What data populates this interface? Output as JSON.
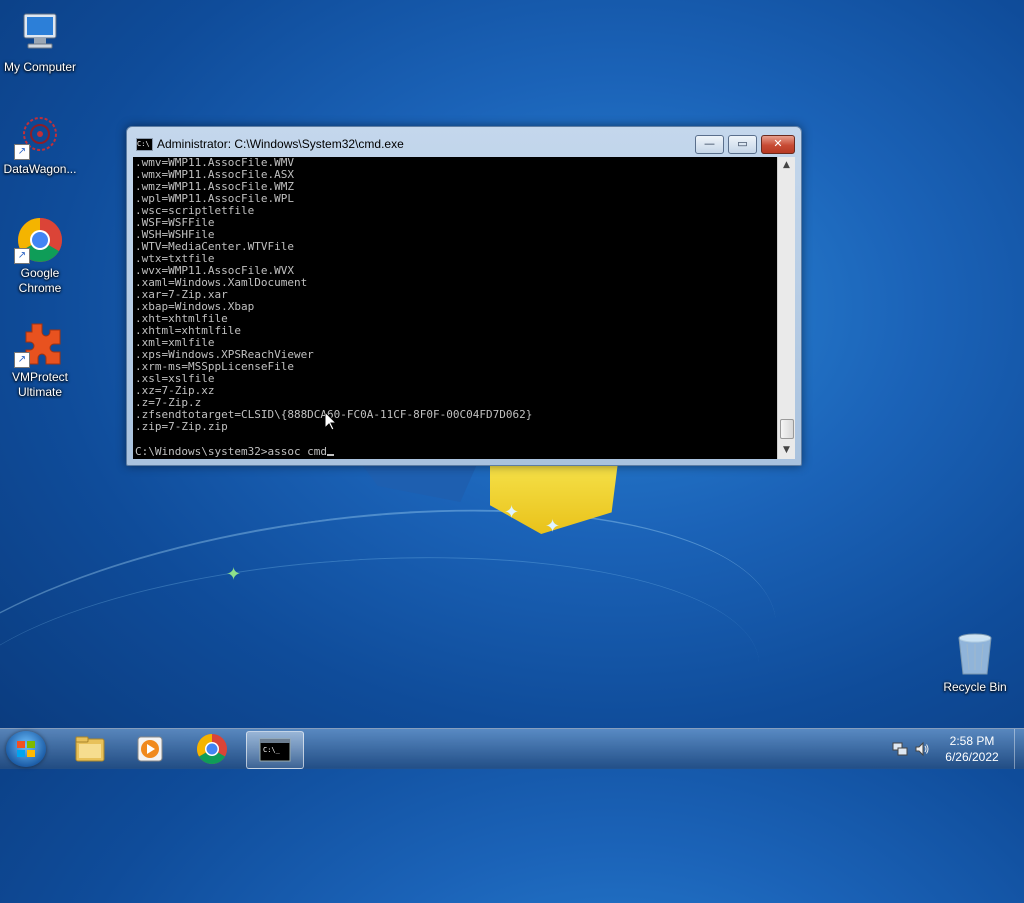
{
  "desktop": {
    "icons": [
      {
        "label": "My Computer"
      },
      {
        "label": "DataWagon..."
      },
      {
        "label": "Google Chrome"
      },
      {
        "label": "VMProtect Ultimate"
      },
      {
        "label": "Recycle Bin"
      }
    ]
  },
  "window": {
    "title": "Administrator: C:\\Windows\\System32\\cmd.exe",
    "icon_text": "C:\\",
    "minimize_label": "—",
    "maximize_label": "▭",
    "close_label": "✕"
  },
  "console": {
    "lines": [
      ".wmv=WMP11.AssocFile.WMV",
      ".wmx=WMP11.AssocFile.ASX",
      ".wmz=WMP11.AssocFile.WMZ",
      ".wpl=WMP11.AssocFile.WPL",
      ".wsc=scriptletfile",
      ".WSF=WSFFile",
      ".WSH=WSHFile",
      ".WTV=MediaCenter.WTVFile",
      ".wtx=txtfile",
      ".wvx=WMP11.AssocFile.WVX",
      ".xaml=Windows.XamlDocument",
      ".xar=7-Zip.xar",
      ".xbap=Windows.Xbap",
      ".xht=xhtmlfile",
      ".xhtml=xhtmlfile",
      ".xml=xmlfile",
      ".xps=Windows.XPSReachViewer",
      ".xrm-ms=MSSppLicenseFile",
      ".xsl=xslfile",
      ".xz=7-Zip.xz",
      ".z=7-Zip.z",
      ".zfsendtotarget=CLSID\\{888DCA60-FC0A-11CF-8F0F-00C04FD7D062}",
      ".zip=7-Zip.zip"
    ],
    "prompt": "C:\\Windows\\system32>assoc cmd"
  },
  "taskbar": {
    "clock_time": "2:58 PM",
    "clock_date": "6/26/2022"
  },
  "colors": {
    "console_bg": "#000000",
    "console_fg": "#c0c0c0",
    "close_red": "#c74a34"
  }
}
